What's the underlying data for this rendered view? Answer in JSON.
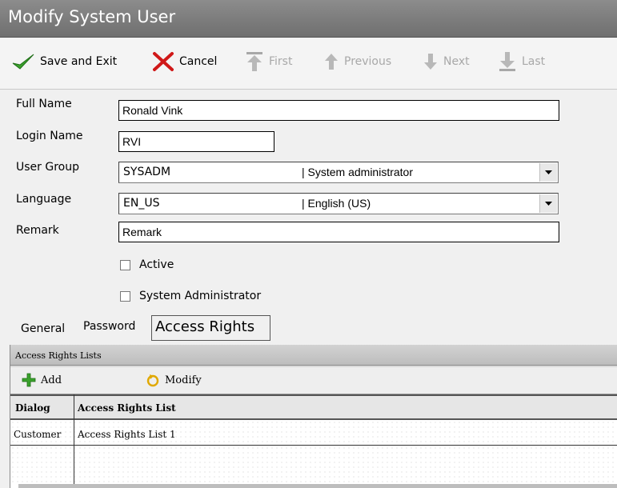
{
  "window": {
    "title": "Modify System User"
  },
  "toolbar": {
    "save_exit": "Save and Exit",
    "cancel": "Cancel",
    "first": "First",
    "previous": "Previous",
    "next": "Next",
    "last": "Last"
  },
  "form": {
    "full_name": {
      "label": "Full Name",
      "value": "Ronald Vink"
    },
    "login_name": {
      "label": "Login Name",
      "value": "RVI"
    },
    "user_group": {
      "label": "User Group",
      "code": "SYSADM",
      "description": "| System administrator"
    },
    "language": {
      "label": "Language",
      "code": "EN_US",
      "description": "| English (US)"
    },
    "remark": {
      "label": "Remark",
      "value": "Remark"
    },
    "active": {
      "label": "Active",
      "checked": false
    },
    "system_admin": {
      "label": "System Administrator",
      "checked": false
    }
  },
  "tabs": [
    "General",
    "Password",
    "Access Rights"
  ],
  "access_panel": {
    "title": "Access Rights Lists",
    "add": "Add",
    "modify": "Modify",
    "columns": [
      "Dialog",
      "Access Rights List"
    ],
    "rows": [
      {
        "dialog": "Customer",
        "list": "Access Rights List 1"
      }
    ]
  },
  "colors": {
    "titlebar": "#7d7d7d",
    "check_green": "#3aa12c",
    "cancel_red": "#d01818"
  }
}
